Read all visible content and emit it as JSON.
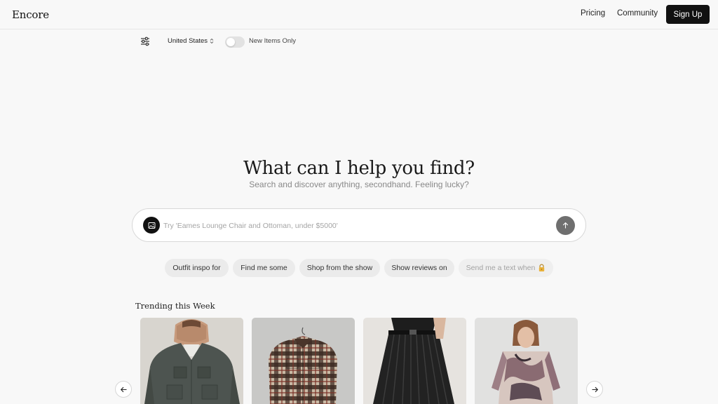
{
  "header": {
    "logo": "Encore",
    "nav": {
      "pricing": "Pricing",
      "community": "Community"
    },
    "signup_label": "Sign Up"
  },
  "toolbar": {
    "filters_icon": "sliders-icon",
    "country": "United States",
    "toggle_label": "New Items Only",
    "toggle_on": false
  },
  "hero": {
    "headline": "What can I help you find?",
    "subhead": "Search and discover anything, secondhand. Feeling lucky?"
  },
  "search": {
    "placeholder": "Try 'Eames Lounge Chair and Ottoman, under $5000'",
    "value": "",
    "image_icon": "image-icon",
    "send_icon": "arrow-up-icon"
  },
  "chips": [
    {
      "label": "Outfit inspo for",
      "disabled": false
    },
    {
      "label": "Find me some",
      "disabled": false
    },
    {
      "label": "Shop from the show",
      "disabled": false
    },
    {
      "label": "Show reviews on",
      "disabled": false
    },
    {
      "label": "Send me a text when",
      "disabled": true,
      "icon": "lock-icon"
    }
  ],
  "trending": {
    "title": "Trending this Week",
    "items": [
      {
        "image": "gray-workwear-jacket"
      },
      {
        "image": "plaid-overshirt"
      },
      {
        "image": "black-pleated-skirt"
      },
      {
        "image": "printed-mesh-top"
      }
    ],
    "prev_icon": "arrow-left-icon",
    "next_icon": "arrow-right-icon"
  },
  "colors": {
    "background": "#f8f8f8",
    "primary": "#111111",
    "chip": "#ebebeb",
    "muted_text": "#888888"
  }
}
